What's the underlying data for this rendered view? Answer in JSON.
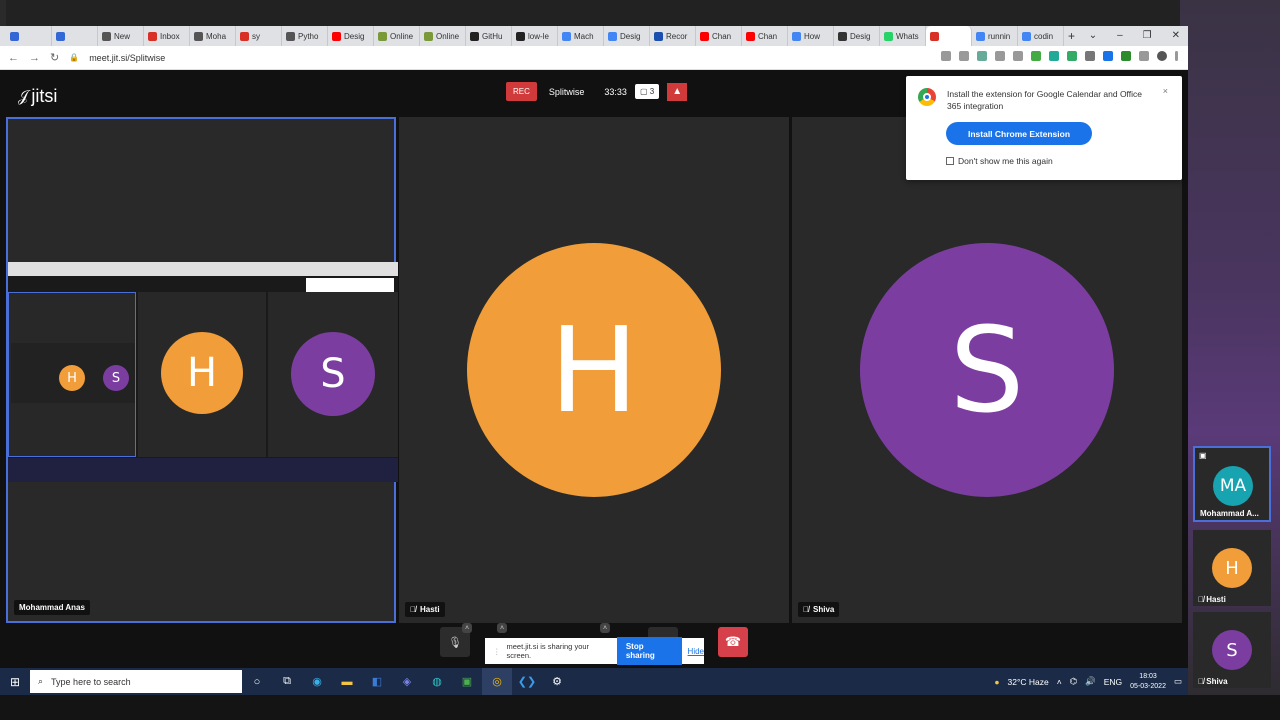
{
  "browser": {
    "tabs": [
      {
        "label": "",
        "color": "#3367d6"
      },
      {
        "label": "",
        "color": "#3367d6"
      },
      {
        "label": "New",
        "color": "#555555"
      },
      {
        "label": "Inbox",
        "color": "#d93025"
      },
      {
        "label": "Moha",
        "color": "#555555"
      },
      {
        "label": "sy",
        "color": "#d93025"
      },
      {
        "label": "Pytho",
        "color": "#555555"
      },
      {
        "label": "Desig",
        "color": "#ff0000"
      },
      {
        "label": "Online",
        "color": "#7a9a3a"
      },
      {
        "label": "Online",
        "color": "#7a9a3a"
      },
      {
        "label": "GitHu",
        "color": "#222222"
      },
      {
        "label": "low-le",
        "color": "#222222"
      },
      {
        "label": "Mach",
        "color": "#4285f4"
      },
      {
        "label": "Desig",
        "color": "#4285f4"
      },
      {
        "label": "Recor",
        "color": "#1a4fb0"
      },
      {
        "label": "Chan",
        "color": "#ff0000"
      },
      {
        "label": "Chan",
        "color": "#ff0000"
      },
      {
        "label": "How",
        "color": "#4285f4"
      },
      {
        "label": "Desig",
        "color": "#333333"
      },
      {
        "label": "Whats",
        "color": "#25d366"
      },
      {
        "label": "",
        "color": "#d93025"
      },
      {
        "label": "runnin",
        "color": "#4285f4"
      },
      {
        "label": "codin",
        "color": "#4285f4"
      }
    ],
    "new_tab": "+",
    "window_controls": [
      "⌄",
      "–",
      "❐",
      "✕"
    ],
    "url": "meet.jit.si/Splitwise"
  },
  "meeting": {
    "logo": "jitsi",
    "rec_label": "REC",
    "room_name": "Splitwise",
    "timer": "33:33",
    "participant_count": "3",
    "warning": "▲",
    "tiles": [
      {
        "name": "Mohammad Anas",
        "muted": false
      },
      {
        "name": "Hasti",
        "initial": "H",
        "color": "#f19d39",
        "muted": true
      },
      {
        "name": "Shiva",
        "initial": "S",
        "color": "#7b3ea0",
        "muted": true
      }
    ],
    "filmstrip": [
      {
        "initials": "MA",
        "name": "Mohammad A...",
        "color": "#18a3b0"
      },
      {
        "initials": "H",
        "name": "Hasti",
        "color": "#f19d39"
      },
      {
        "initials": "S",
        "name": "Shiva",
        "color": "#7b3ea0"
      }
    ],
    "nested_tiles": [
      "H",
      "S"
    ]
  },
  "popup": {
    "text": "Install the extension for Google Calendar and Office 365 integration",
    "button": "Install Chrome Extension",
    "checkbox": "Don't show me this again",
    "close": "×"
  },
  "share_bar": {
    "text": "meet.jit.si is sharing your screen.",
    "stop": "Stop sharing",
    "hide": "Hide"
  },
  "taskbar": {
    "search_placeholder": "Type here to search",
    "weather": "32°C  Haze",
    "lang": "ENG",
    "time": "18:03",
    "date": "05-03-2022"
  }
}
